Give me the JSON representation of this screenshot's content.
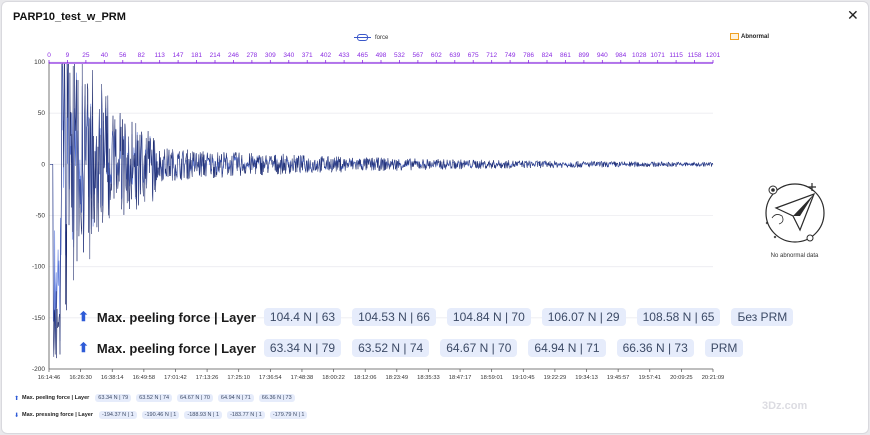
{
  "dialog": {
    "title": "PARP10_test_w_PRM",
    "close_glyph": "✕"
  },
  "legend": {
    "series_name": "force",
    "abnormal_label": "Abnormal"
  },
  "empty_state": {
    "text": "No abnormal data",
    "icon": "paper-plane-icon"
  },
  "watermark": "3Dz.com",
  "colors": {
    "series": "#1d2a6b",
    "series_light": "#3c5fd6",
    "top_axis": "#8a2be2",
    "chip_bg": "#e6ecfb",
    "accent": "#2e5bd7"
  },
  "chart_data": {
    "type": "line",
    "series": [
      {
        "name": "force"
      }
    ],
    "y_ticks": [
      "100",
      "50",
      "0",
      "-50",
      "-100",
      "-150",
      "-200"
    ],
    "ylim": [
      -200,
      100
    ],
    "top_axis_ticks": [
      "0",
      "9",
      "25",
      "40",
      "56",
      "82",
      "113",
      "147",
      "181",
      "214",
      "246",
      "278",
      "309",
      "340",
      "371",
      "402",
      "433",
      "465",
      "498",
      "532",
      "567",
      "602",
      "639",
      "675",
      "712",
      "749",
      "786",
      "824",
      "861",
      "899",
      "940",
      "984",
      "1028",
      "1071",
      "1115",
      "1158",
      "1201"
    ],
    "bottom_axis_ticks": [
      "16:14:46",
      "16:26:30",
      "16:38:14",
      "16:49:58",
      "17:01:42",
      "17:13:26",
      "17:25:10",
      "17:36:54",
      "17:48:38",
      "18:00:22",
      "18:12:06",
      "18:23:49",
      "18:35:33",
      "18:47:17",
      "18:59:01",
      "19:10:45",
      "19:22:29",
      "19:34:13",
      "19:45:57",
      "19:57:41",
      "20:09:25",
      "20:21:09"
    ],
    "grid": true,
    "legend_position": "top-center"
  },
  "annotations": {
    "row1": {
      "label": "Max. peeling force | Layer",
      "chips": [
        "104.4 N | 63",
        "104.53 N | 66",
        "104.84 N | 70",
        "106.07 N | 29",
        "108.58 N | 65"
      ],
      "tag": "Без PRM"
    },
    "row2": {
      "label": "Max. peeling force | Layer",
      "chips": [
        "63.34 N | 79",
        "63.52 N | 74",
        "64.67 N | 70",
        "64.94 N | 71",
        "66.36 N | 73"
      ],
      "tag": "PRM"
    }
  },
  "summary": {
    "peeling": {
      "label": "Max. peeling force | Layer",
      "chips": [
        "63.34 N | 79",
        "63.52 N | 74",
        "64.67 N | 70",
        "64.94 N | 71",
        "66.36 N | 73"
      ]
    },
    "pressing": {
      "label": "Max. pressing force | Layer",
      "chips": [
        "-194.37 N | 1",
        "-190.46 N | 1",
        "-188.93 N | 1",
        "-183.77 N | 1",
        "-179.79 N | 1"
      ]
    }
  }
}
